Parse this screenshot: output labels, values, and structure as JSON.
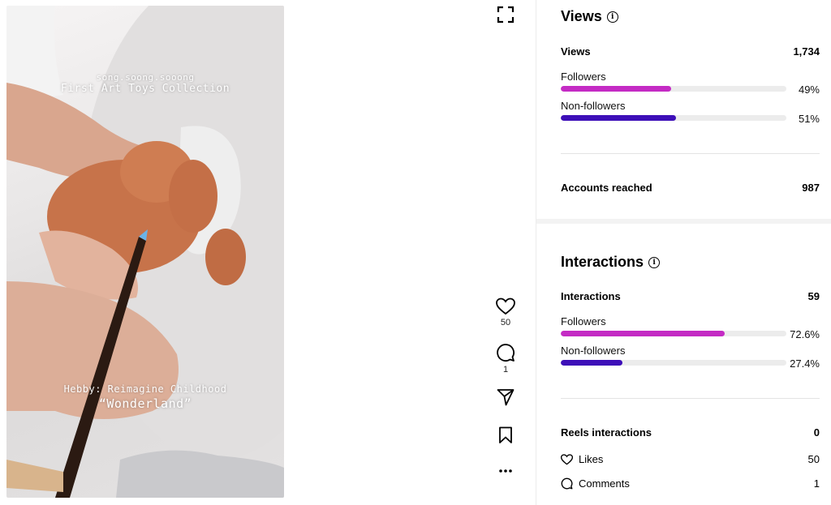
{
  "video": {
    "account": "song.soong.sooong",
    "collection": "First Art Toys Collection",
    "caption_line1": "Hebby: Reimagine Childhood",
    "caption_line2": "“Wonderland”"
  },
  "actions": {
    "fullscreen_icon": "fullscreen-icon",
    "likes_count": "50",
    "comments_count": "1",
    "share_icon": "share-icon",
    "save_icon": "bookmark-icon",
    "more_icon": "more-icon"
  },
  "views": {
    "title": "Views",
    "total_label": "Views",
    "total_value": "1,734",
    "followers_label": "Followers",
    "followers_pct": "49%",
    "followers_fraction": 0.49,
    "nonfollowers_label": "Non-followers",
    "nonfollowers_pct": "51%",
    "nonfollowers_fraction": 0.51,
    "reached_label": "Accounts reached",
    "reached_value": "987"
  },
  "interactions": {
    "title": "Interactions",
    "total_label": "Interactions",
    "total_value": "59",
    "followers_label": "Followers",
    "followers_pct": "72.6%",
    "followers_fraction": 0.726,
    "nonfollowers_label": "Non-followers",
    "nonfollowers_pct": "27.4%",
    "nonfollowers_fraction": 0.274,
    "reels_label": "Reels interactions",
    "reels_value": "0",
    "likes_label": "Likes",
    "likes_value": "50",
    "comments_label": "Comments",
    "comments_value": "1"
  },
  "colors": {
    "followers_bar": "#c42bc4",
    "nonfollowers_bar": "#3d0fb8"
  }
}
